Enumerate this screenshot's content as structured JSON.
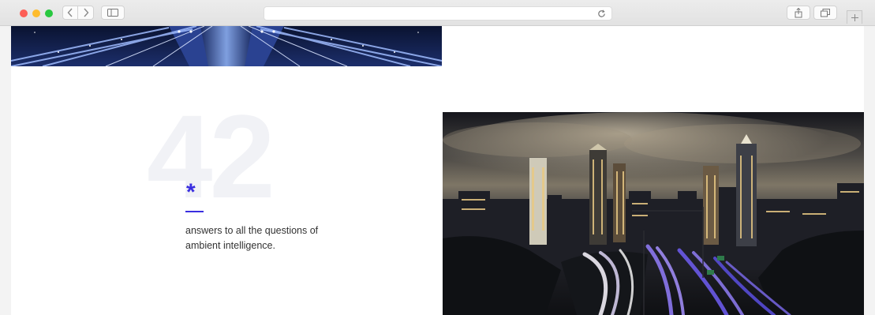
{
  "browser": {
    "address": "",
    "icons": {
      "back": "chevron-left-icon",
      "forward": "chevron-right-icon",
      "sidebar": "sidebar-icon",
      "reload": "reload-icon",
      "share": "share-icon",
      "tabs": "tabs-icon",
      "new_tab": "plus-icon"
    }
  },
  "section": {
    "big_number": "42",
    "asterisk": "*",
    "tagline": "answers to all the questions of ambient intelligence."
  },
  "colors": {
    "accent": "#3a2ee0",
    "big_number": "#f1f2f6",
    "page_bg": "#ffffff"
  }
}
